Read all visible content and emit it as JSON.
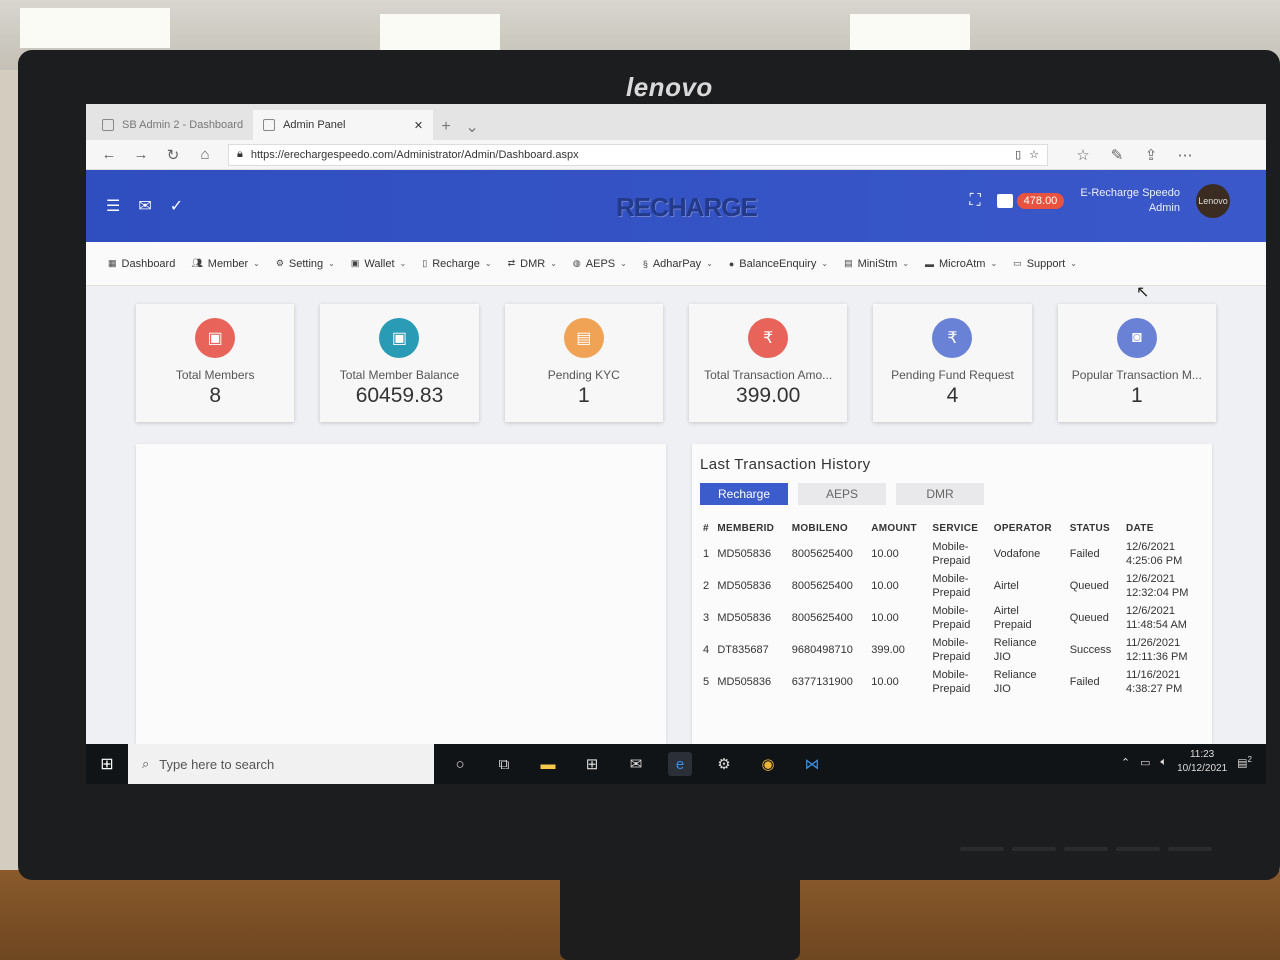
{
  "monitor": {
    "brand": "lenovo"
  },
  "browser": {
    "tabs": [
      {
        "label": "SB Admin 2 - Dashboard",
        "active": false
      },
      {
        "label": "Admin Panel",
        "active": true
      }
    ],
    "url": "https://erechargespeedo.com/Administrator/Admin/Dashboard.aspx"
  },
  "header": {
    "logo_text": "RECHARGE",
    "balance": "478.00",
    "user_line1": "E-Recharge Speedo",
    "user_line2": "Admin",
    "avatar_text": "Lenovo",
    "accent_color": "#3a58c9"
  },
  "menu": [
    {
      "label": "Dashboard",
      "icon": "dashboard-icon",
      "dropdown": false
    },
    {
      "label": "Member",
      "icon": "users-icon",
      "dropdown": true
    },
    {
      "label": "Setting",
      "icon": "gear-icon",
      "dropdown": true
    },
    {
      "label": "Wallet",
      "icon": "wallet-icon",
      "dropdown": true
    },
    {
      "label": "Recharge",
      "icon": "mobile-icon",
      "dropdown": true
    },
    {
      "label": "DMR",
      "icon": "transfer-icon",
      "dropdown": true
    },
    {
      "label": "AEPS",
      "icon": "fingerprint-icon",
      "dropdown": true
    },
    {
      "label": "AdharPay",
      "icon": "pay-icon",
      "dropdown": true
    },
    {
      "label": "BalanceEnquiry",
      "icon": "circle-icon",
      "dropdown": true
    },
    {
      "label": "MiniStm",
      "icon": "document-icon",
      "dropdown": true
    },
    {
      "label": "MicroAtm",
      "icon": "card-icon",
      "dropdown": true
    },
    {
      "label": "Support",
      "icon": "support-icon",
      "dropdown": true
    }
  ],
  "cards": [
    {
      "title": "Total Members",
      "value": "8",
      "icon": "member-icon",
      "color": "#e8645a"
    },
    {
      "title": "Total Member Balance",
      "value": "60459.83",
      "icon": "wallet-icon",
      "color": "#2a9bb5"
    },
    {
      "title": "Pending KYC",
      "value": "1",
      "icon": "document-icon",
      "color": "#f0a255"
    },
    {
      "title": "Total Transaction Amo...",
      "value": "399.00",
      "icon": "rupee-icon",
      "color": "#e8645a"
    },
    {
      "title": "Pending Fund Request",
      "value": "4",
      "icon": "rupee-icon",
      "color": "#6a82d6"
    },
    {
      "title": "Popular Transaction M...",
      "value": "1",
      "icon": "camera-icon",
      "color": "#6a82d6"
    }
  ],
  "transactions": {
    "title": "Last Transaction History",
    "tabs": [
      "Recharge",
      "AEPS",
      "DMR"
    ],
    "active_tab": "Recharge",
    "columns": [
      "#",
      "MEMBERID",
      "MOBILENO",
      "AMOUNT",
      "SERVICE",
      "OPERATOR",
      "STATUS",
      "DATE"
    ],
    "rows": [
      {
        "n": "1",
        "memberid": "MD505836",
        "mobile": "8005625400",
        "amount": "10.00",
        "service1": "Mobile-",
        "service2": "Prepaid",
        "operator1": "Vodafone",
        "operator2": "",
        "status": "Failed",
        "date1": "12/6/2021",
        "date2": "4:25:06 PM"
      },
      {
        "n": "2",
        "memberid": "MD505836",
        "mobile": "8005625400",
        "amount": "10.00",
        "service1": "Mobile-",
        "service2": "Prepaid",
        "operator1": "Airtel",
        "operator2": "",
        "status": "Queued",
        "date1": "12/6/2021",
        "date2": "12:32:04 PM"
      },
      {
        "n": "3",
        "memberid": "MD505836",
        "mobile": "8005625400",
        "amount": "10.00",
        "service1": "Mobile-",
        "service2": "Prepaid",
        "operator1": "Airtel",
        "operator2": "Prepaid",
        "status": "Queued",
        "date1": "12/6/2021",
        "date2": "11:48:54 AM"
      },
      {
        "n": "4",
        "memberid": "DT835687",
        "mobile": "9680498710",
        "amount": "399.00",
        "service1": "Mobile-",
        "service2": "Prepaid",
        "operator1": "Reliance",
        "operator2": "JIO",
        "status": "Success",
        "date1": "11/26/2021",
        "date2": "12:11:36 PM"
      },
      {
        "n": "5",
        "memberid": "MD505836",
        "mobile": "6377131900",
        "amount": "10.00",
        "service1": "Mobile-",
        "service2": "Prepaid",
        "operator1": "Reliance",
        "operator2": "JIO",
        "status": "Failed",
        "date1": "11/16/2021",
        "date2": "4:38:27 PM"
      }
    ]
  },
  "taskbar": {
    "search_placeholder": "Type here to search",
    "time": "11:23",
    "date": "10/12/2021",
    "notification_count": "2"
  }
}
